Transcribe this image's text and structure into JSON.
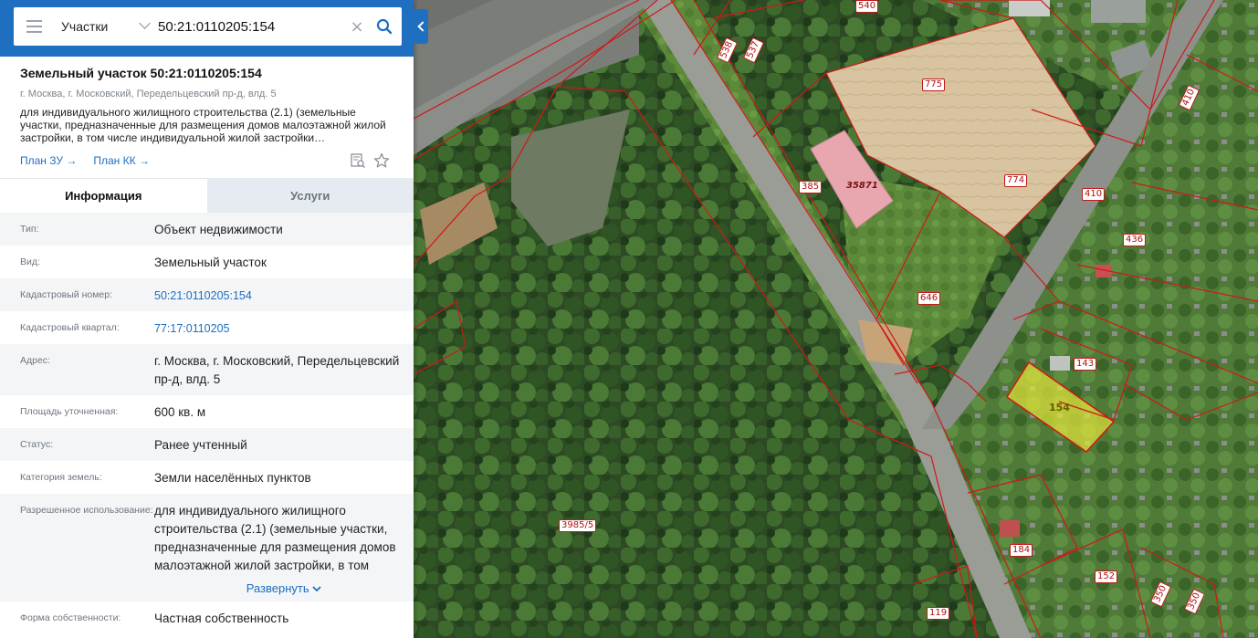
{
  "search": {
    "type_label": "Участки",
    "query": "50:21:0110205:154",
    "clear_glyph": "×"
  },
  "object": {
    "title": "Земельный участок 50:21:0110205:154",
    "address": "г. Москва, г. Московский, Передельцевский пр-д, влд. 5",
    "description": "для индивидуального жилищного строительства (2.1) (земельные участки, предназначенные для размещения домов малоэтажной жилой застройки, в том числе индивидуальной жилой застройки…",
    "plan_zu": "План ЗУ →",
    "plan_kk": "План КК →"
  },
  "tabs": {
    "info": "Информация",
    "services": "Услуги"
  },
  "info": {
    "type_label": "Тип:",
    "type_value": "Объект недвижимости",
    "kind_label": "Вид:",
    "kind_value": "Земельный участок",
    "cad_num_label": "Кадастровый номер:",
    "cad_num_value": "50:21:0110205:154",
    "cad_block_label": "Кадастровый квартал:",
    "cad_block_value": "77:17:0110205",
    "address_label": "Адрес:",
    "address_value": "г. Москва, г. Московский, Передельцевский пр-д, влд. 5",
    "area_label": "Площадь уточненная:",
    "area_value": "600 кв. м",
    "status_label": "Статус:",
    "status_value": "Ранее учтенный",
    "category_label": "Категория земель:",
    "category_value": "Земли населённых пунктов",
    "use_label": "Разрешенное использование:",
    "use_value": "для индивидуального жилищного строительства (2.1) (земельные участки, предназначенные для размещения домов малоэтажной жилой застройки, в том числе",
    "expand_label": "Развернуть",
    "ownership_label": "Форма собственности:",
    "ownership_value": "Частная собственность"
  },
  "map": {
    "parcel_labels": [
      "540",
      "538",
      "537",
      "775",
      "774",
      "410",
      "410",
      "385",
      "35871",
      "436",
      "646",
      "143",
      "154",
      "3985/5",
      "184",
      "152",
      "350",
      "350",
      "119"
    ]
  },
  "colors": {
    "brand_blue": "#1e6fc0",
    "parcel_line": "#d01818",
    "selected_fill": "#e6e83a"
  }
}
